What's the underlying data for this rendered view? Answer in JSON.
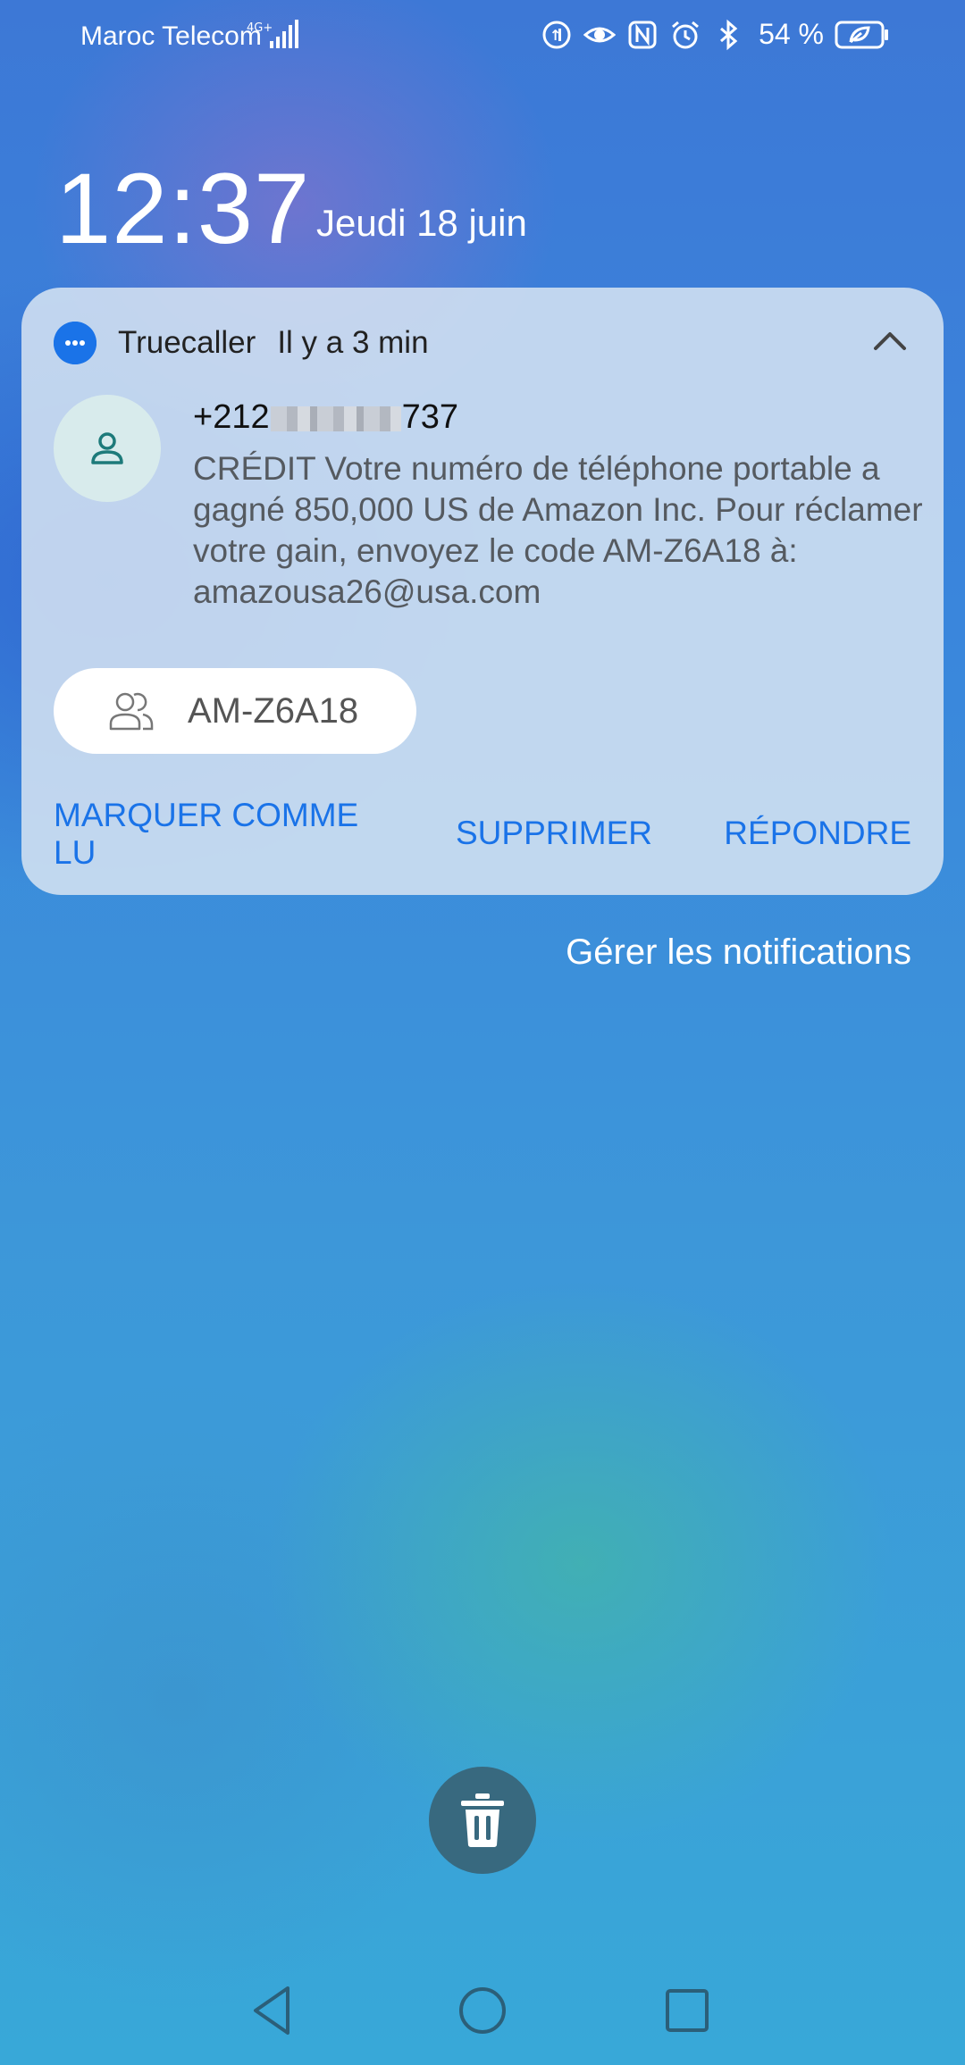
{
  "status_bar": {
    "carrier": "Maroc Telecom",
    "network": "4G+",
    "battery_percent": "54 %",
    "icons": [
      "data-saver-icon",
      "eye-comfort-icon",
      "nfc-icon",
      "alarm-icon",
      "bluetooth-icon",
      "battery-saver-icon"
    ]
  },
  "lockscreen": {
    "time": "12:37",
    "date": "Jeudi 18 juin"
  },
  "notification": {
    "app_name": "Truecaller",
    "time_ago": "Il y a 3 min",
    "sender_prefix": "+212",
    "sender_suffix": "737",
    "message": "CRÉDIT Votre numéro de téléphone portable a gagné 850,000 US de Amazon Inc. Pour réclamer votre gain, envoyez le code AM-Z6A18 à: amazousa26@usa.com",
    "chip_label": "AM-Z6A18",
    "actions": {
      "mark_read": "MARQUER COMME LU",
      "delete": "SUPPRIMER",
      "reply": "RÉPONDRE"
    },
    "accent_color": "#1a73e8"
  },
  "manage_link": "Gérer les notifications"
}
